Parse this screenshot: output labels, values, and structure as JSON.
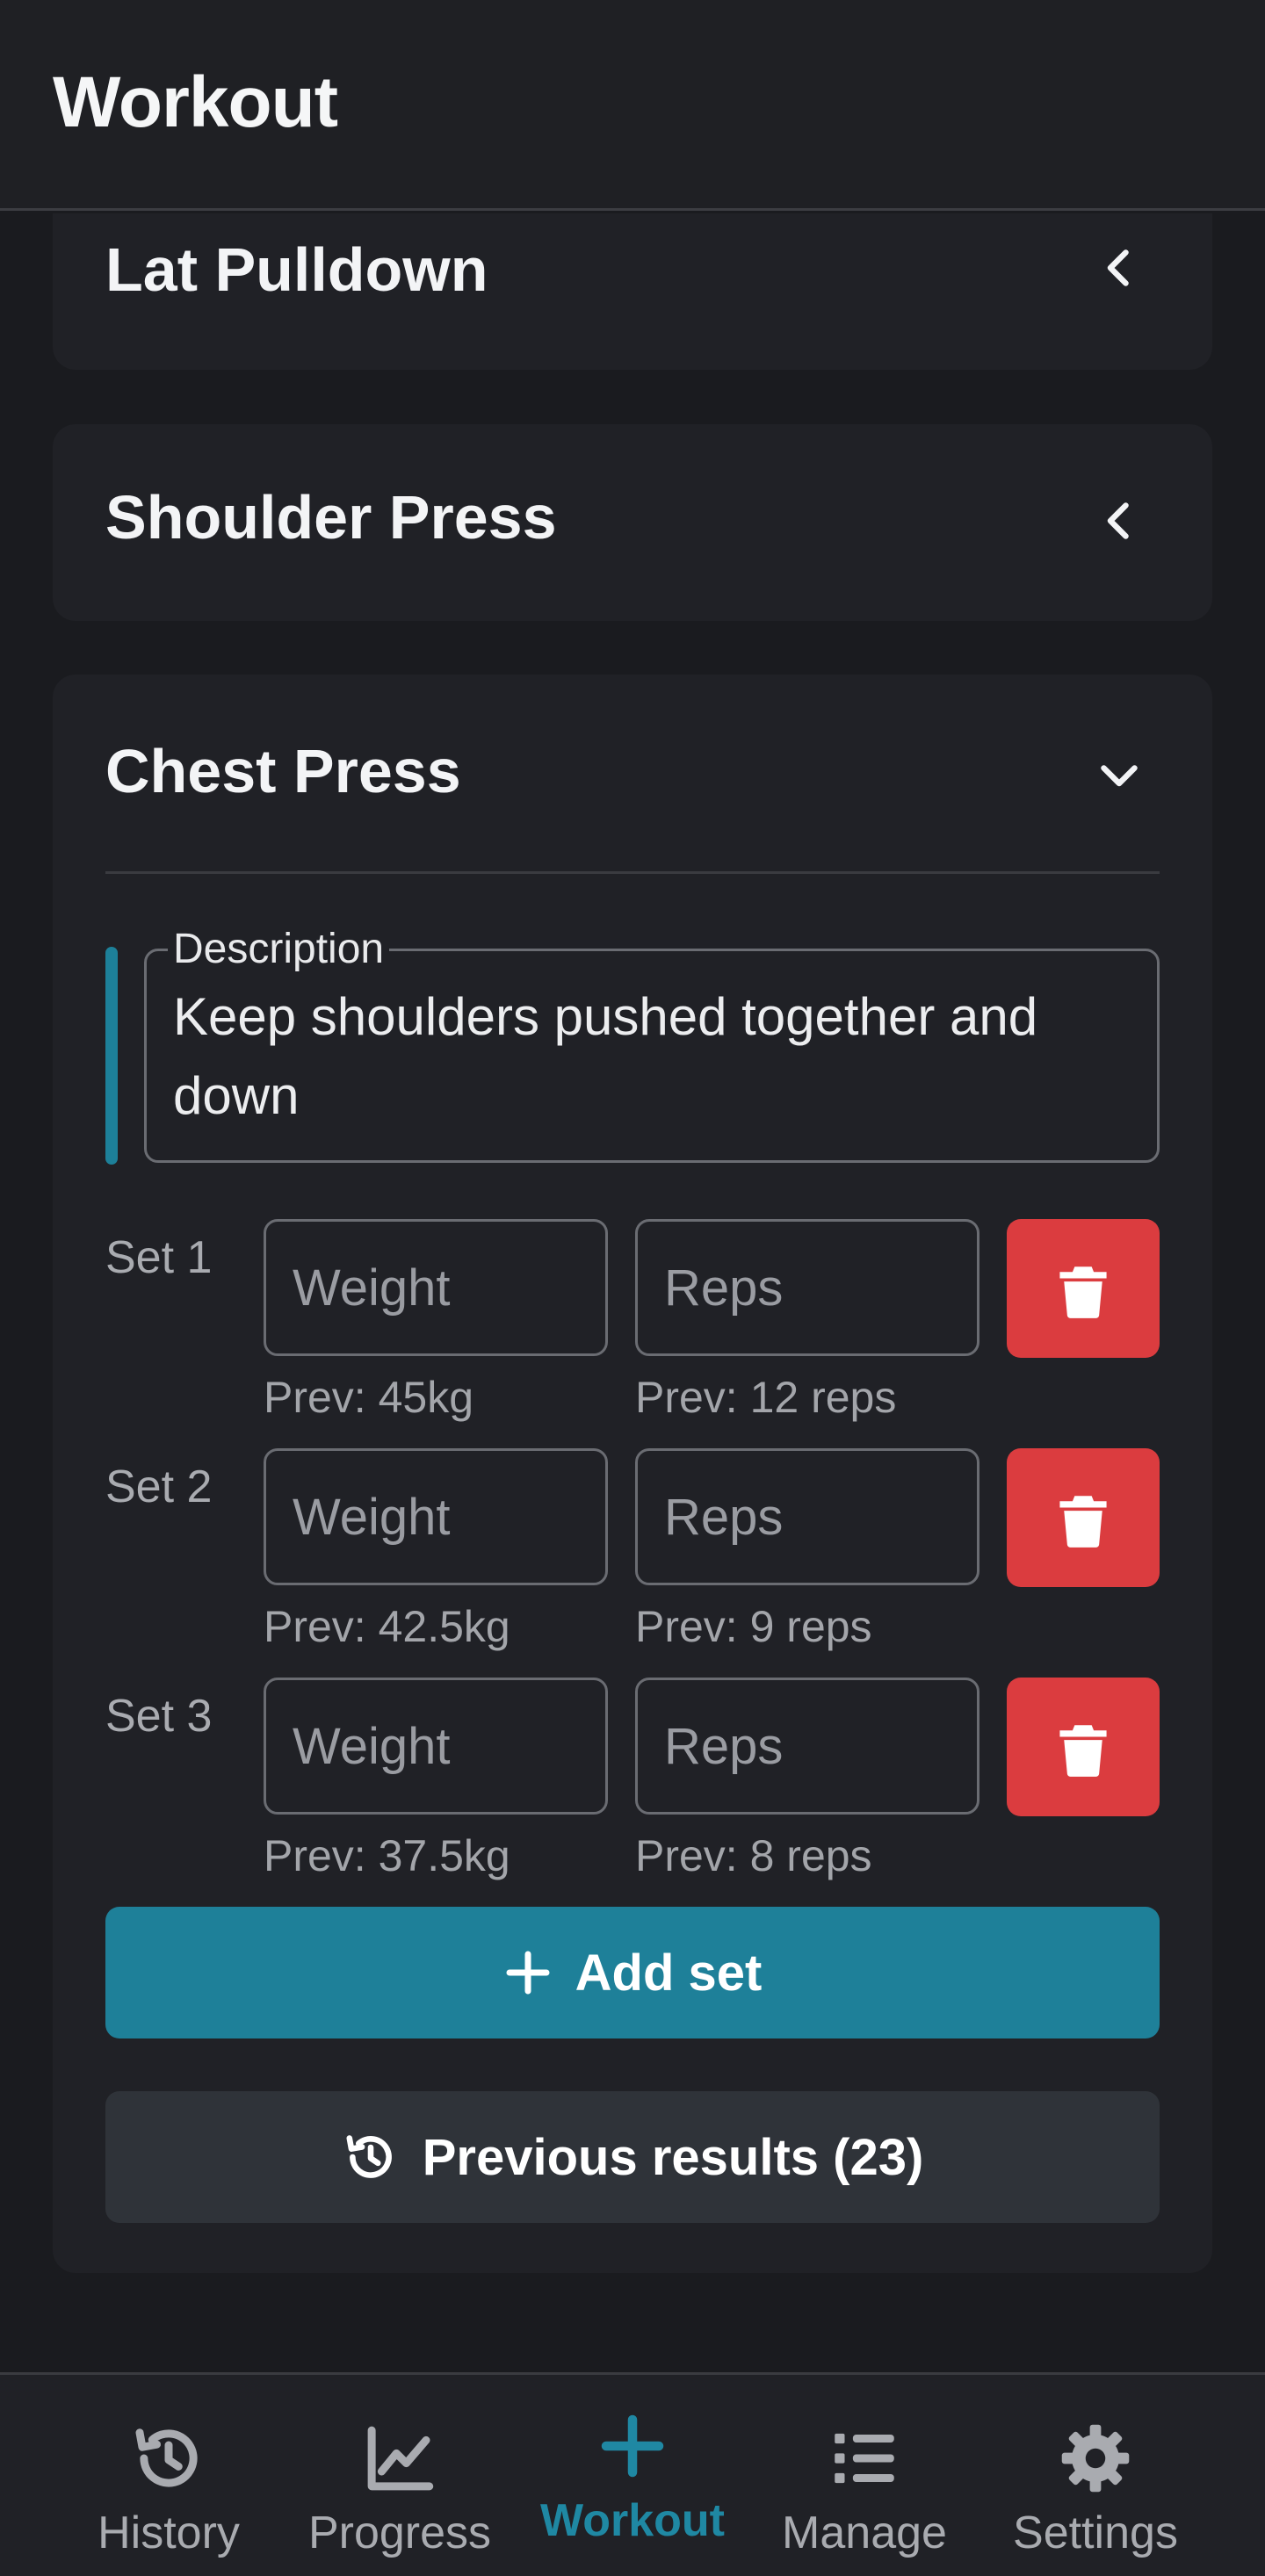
{
  "header": {
    "title": "Workout"
  },
  "exercises": [
    {
      "name": "Lat Pulldown",
      "expanded": false
    },
    {
      "name": "Shoulder Press",
      "expanded": false
    },
    {
      "name": "Chest Press",
      "expanded": true
    }
  ],
  "active_exercise": {
    "description_label": "Description",
    "description_text": "Keep shoulders pushed together and down",
    "weight_placeholder": "Weight",
    "reps_placeholder": "Reps",
    "sets": [
      {
        "label": "Set 1",
        "prev_weight": "Prev: 45kg",
        "prev_reps": "Prev: 12 reps"
      },
      {
        "label": "Set 2",
        "prev_weight": "Prev: 42.5kg",
        "prev_reps": "Prev: 9 reps"
      },
      {
        "label": "Set 3",
        "prev_weight": "Prev: 37.5kg",
        "prev_reps": "Prev: 8 reps"
      }
    ],
    "add_set_label": "Add set",
    "previous_results_label": "Previous results (23)"
  },
  "nav": {
    "items": [
      {
        "label": "History",
        "icon": "history-icon",
        "active": false
      },
      {
        "label": "Progress",
        "icon": "chart-icon",
        "active": false
      },
      {
        "label": "Workout",
        "icon": "plus-icon",
        "active": true
      },
      {
        "label": "Manage",
        "icon": "list-icon",
        "active": false
      },
      {
        "label": "Settings",
        "icon": "gear-icon",
        "active": false
      }
    ]
  },
  "colors": {
    "accent": "#1e8099",
    "danger": "#db3c3f",
    "background": "#1a1b1f",
    "card": "#202126"
  }
}
